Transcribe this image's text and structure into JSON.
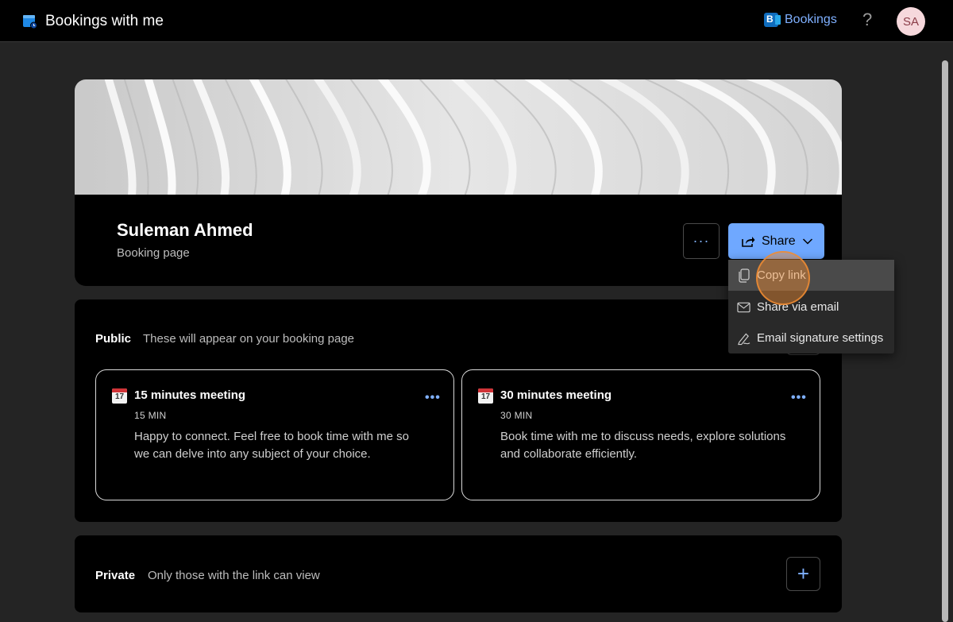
{
  "header": {
    "app_title": "Bookings with me",
    "bookings_link": "Bookings",
    "bookings_badge": "B",
    "help": "?",
    "avatar_initials": "SA"
  },
  "profile": {
    "name": "Suleman Ahmed",
    "subtitle": "Booking page",
    "more_label": "···",
    "share_label": "Share"
  },
  "share_menu": {
    "items": [
      {
        "label": "Copy link",
        "icon": "copy-icon"
      },
      {
        "label": "Share via email",
        "icon": "mail-icon"
      },
      {
        "label": "Email signature settings",
        "icon": "signature-icon"
      }
    ]
  },
  "public_section": {
    "label": "Public",
    "description": "These will appear on your booking page",
    "meetings": [
      {
        "title": "15 minutes meeting",
        "duration": "15 MIN",
        "description": "Happy to connect. Feel free to book time with me so we can delve into any subject of your choice.",
        "calendar_day": "17"
      },
      {
        "title": "30 minutes meeting",
        "duration": "30 MIN",
        "description": "Book time with me to discuss needs, explore solutions and collaborate efficiently.",
        "calendar_day": "17"
      }
    ]
  },
  "private_section": {
    "label": "Private",
    "description": "Only those with the link can view",
    "add_label": "+"
  },
  "colors": {
    "accent": "#6fa8ff",
    "link": "#7fb0ff",
    "background": "#242424",
    "card": "#000000"
  }
}
